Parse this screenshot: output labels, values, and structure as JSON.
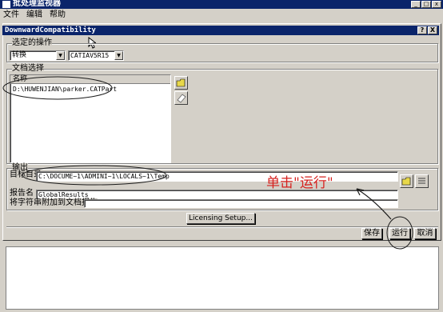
{
  "window": {
    "title": "批处理监视器"
  },
  "menu": [
    "文件",
    "编辑",
    "帮助"
  ],
  "dialog": {
    "title": "DownwardCompatibility",
    "title_buttons": [
      "?",
      "X"
    ],
    "operation": {
      "label": "选定的操作",
      "action_value": "转换",
      "target_value": "CATIAV5R15"
    },
    "documents": {
      "label": "文档选择",
      "column_header": "名称",
      "items": [
        "D:\\HUWENJIAN\\parker.CATPart"
      ]
    },
    "output": {
      "label": "输出",
      "target_dir_label": "目标目录",
      "target_dir_value": "C:\\DOCUME~1\\ADMINI~1\\LOCALS~1\\Temp",
      "report_name_label": "报告名",
      "report_name_value": "GlobalResults",
      "append_label": "将字符串附加到文档报告"
    },
    "licensing_button": "Licensing Setup...",
    "buttons": {
      "save": "保存",
      "run": "运行",
      "cancel": "取消"
    }
  },
  "annotation": {
    "text": "单击\"运行\"",
    "color": "#d6211e"
  }
}
